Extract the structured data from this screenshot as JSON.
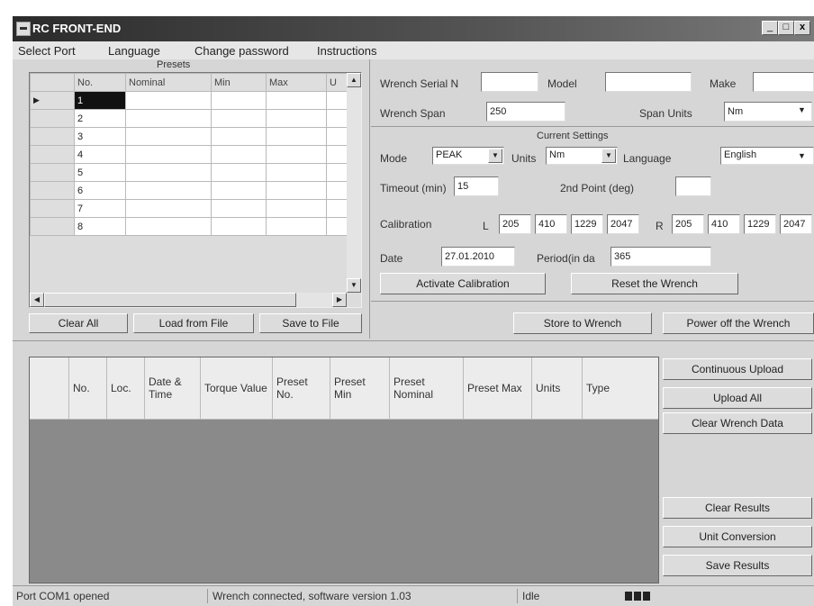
{
  "window": {
    "title": "RC FRONT-END",
    "minimize": "_",
    "maximize": "□",
    "close": "x"
  },
  "menu": [
    "Select Port",
    "Language",
    "Change password",
    "Instructions"
  ],
  "presets": {
    "title": "Presets",
    "columns": [
      "No.",
      "Nominal",
      "Min",
      "Max",
      "U"
    ],
    "rows": [
      "1",
      "2",
      "3",
      "4",
      "5",
      "6",
      "7",
      "8"
    ],
    "buttons": {
      "clear_all": "Clear All",
      "load": "Load from File",
      "save": "Save to File"
    }
  },
  "wrench": {
    "serial_label": "Wrench Serial N",
    "serial_value": "",
    "model_label": "Model",
    "model_value": "",
    "make_label": "Make",
    "make_value": "",
    "span_label": "Wrench Span",
    "span_value": "250",
    "span_units_label": "Span Units",
    "span_units_value": "Nm"
  },
  "settings": {
    "title": "Current Settings",
    "mode_label": "Mode",
    "mode_value": "PEAK",
    "units_label": "Units",
    "units_value": "Nm",
    "language_label": "Language",
    "language_value": "English",
    "timeout_label": "Timeout (min)",
    "timeout_value": "15",
    "second_point_label": "2nd Point (deg)",
    "second_point_value": "",
    "calibration_label": "Calibration",
    "cal_l_label": "L",
    "cal_l": [
      "205",
      "410",
      "1229",
      "2047"
    ],
    "cal_r_label": "R",
    "cal_r": [
      "205",
      "410",
      "1229",
      "2047"
    ],
    "date_label": "Date",
    "date_value": "27.01.2010",
    "period_label": "Period(in da",
    "period_value": "365",
    "activate_button": "Activate Calibration",
    "reset_button": "Reset the Wrench",
    "store_button": "Store to Wrench",
    "power_off_button": "Power off the Wrench"
  },
  "results": {
    "columns": [
      "No.",
      "Loc.",
      "Date & Time",
      "Torque Value",
      "Preset No.",
      "Preset Min",
      "Preset Nominal",
      "Preset Max",
      "Units",
      "Type"
    ],
    "buttons": {
      "continuous_upload": "Continuous Upload",
      "upload_all": "Upload All",
      "clear_wrench": "Clear Wrench Data",
      "clear_results": "Clear Results",
      "unit_conversion": "Unit Conversion",
      "save_results": "Save Results"
    }
  },
  "status": {
    "port": "Port COM1 opened",
    "wrench": "Wrench connected, software version 1.03",
    "state": "Idle"
  }
}
